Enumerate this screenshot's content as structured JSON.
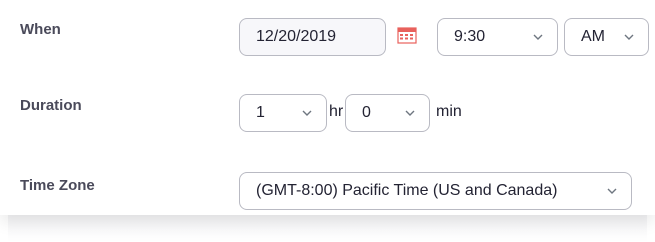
{
  "when": {
    "label": "When",
    "date": "12/20/2019",
    "time": "9:30",
    "ampm": "AM"
  },
  "duration": {
    "label": "Duration",
    "hours": "1",
    "hours_unit": "hr",
    "minutes": "0",
    "minutes_unit": "min"
  },
  "timezone": {
    "label": "Time Zone",
    "value": "(GMT-8:00) Pacific Time (US and Canada)"
  },
  "icons": {
    "calendar": "calendar-icon",
    "dropdown": "chevron-down-icon"
  },
  "colors": {
    "calendar_accent": "#e8615c"
  }
}
